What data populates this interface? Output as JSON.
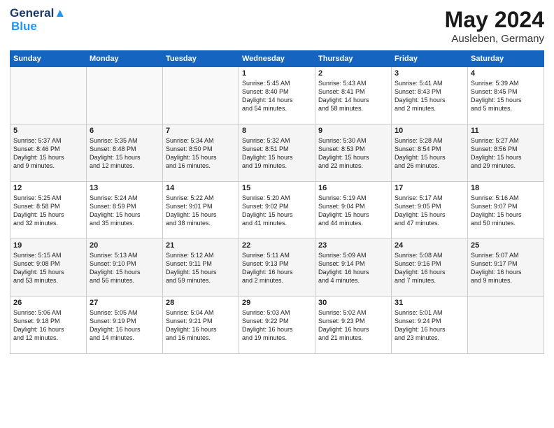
{
  "header": {
    "logo_line1": "General",
    "logo_line2": "Blue",
    "month": "May 2024",
    "location": "Ausleben, Germany"
  },
  "weekdays": [
    "Sunday",
    "Monday",
    "Tuesday",
    "Wednesday",
    "Thursday",
    "Friday",
    "Saturday"
  ],
  "weeks": [
    [
      {
        "day": "",
        "info": ""
      },
      {
        "day": "",
        "info": ""
      },
      {
        "day": "",
        "info": ""
      },
      {
        "day": "1",
        "info": "Sunrise: 5:45 AM\nSunset: 8:40 PM\nDaylight: 14 hours\nand 54 minutes."
      },
      {
        "day": "2",
        "info": "Sunrise: 5:43 AM\nSunset: 8:41 PM\nDaylight: 14 hours\nand 58 minutes."
      },
      {
        "day": "3",
        "info": "Sunrise: 5:41 AM\nSunset: 8:43 PM\nDaylight: 15 hours\nand 2 minutes."
      },
      {
        "day": "4",
        "info": "Sunrise: 5:39 AM\nSunset: 8:45 PM\nDaylight: 15 hours\nand 5 minutes."
      }
    ],
    [
      {
        "day": "5",
        "info": "Sunrise: 5:37 AM\nSunset: 8:46 PM\nDaylight: 15 hours\nand 9 minutes."
      },
      {
        "day": "6",
        "info": "Sunrise: 5:35 AM\nSunset: 8:48 PM\nDaylight: 15 hours\nand 12 minutes."
      },
      {
        "day": "7",
        "info": "Sunrise: 5:34 AM\nSunset: 8:50 PM\nDaylight: 15 hours\nand 16 minutes."
      },
      {
        "day": "8",
        "info": "Sunrise: 5:32 AM\nSunset: 8:51 PM\nDaylight: 15 hours\nand 19 minutes."
      },
      {
        "day": "9",
        "info": "Sunrise: 5:30 AM\nSunset: 8:53 PM\nDaylight: 15 hours\nand 22 minutes."
      },
      {
        "day": "10",
        "info": "Sunrise: 5:28 AM\nSunset: 8:54 PM\nDaylight: 15 hours\nand 26 minutes."
      },
      {
        "day": "11",
        "info": "Sunrise: 5:27 AM\nSunset: 8:56 PM\nDaylight: 15 hours\nand 29 minutes."
      }
    ],
    [
      {
        "day": "12",
        "info": "Sunrise: 5:25 AM\nSunset: 8:58 PM\nDaylight: 15 hours\nand 32 minutes."
      },
      {
        "day": "13",
        "info": "Sunrise: 5:24 AM\nSunset: 8:59 PM\nDaylight: 15 hours\nand 35 minutes."
      },
      {
        "day": "14",
        "info": "Sunrise: 5:22 AM\nSunset: 9:01 PM\nDaylight: 15 hours\nand 38 minutes."
      },
      {
        "day": "15",
        "info": "Sunrise: 5:20 AM\nSunset: 9:02 PM\nDaylight: 15 hours\nand 41 minutes."
      },
      {
        "day": "16",
        "info": "Sunrise: 5:19 AM\nSunset: 9:04 PM\nDaylight: 15 hours\nand 44 minutes."
      },
      {
        "day": "17",
        "info": "Sunrise: 5:17 AM\nSunset: 9:05 PM\nDaylight: 15 hours\nand 47 minutes."
      },
      {
        "day": "18",
        "info": "Sunrise: 5:16 AM\nSunset: 9:07 PM\nDaylight: 15 hours\nand 50 minutes."
      }
    ],
    [
      {
        "day": "19",
        "info": "Sunrise: 5:15 AM\nSunset: 9:08 PM\nDaylight: 15 hours\nand 53 minutes."
      },
      {
        "day": "20",
        "info": "Sunrise: 5:13 AM\nSunset: 9:10 PM\nDaylight: 15 hours\nand 56 minutes."
      },
      {
        "day": "21",
        "info": "Sunrise: 5:12 AM\nSunset: 9:11 PM\nDaylight: 15 hours\nand 59 minutes."
      },
      {
        "day": "22",
        "info": "Sunrise: 5:11 AM\nSunset: 9:13 PM\nDaylight: 16 hours\nand 2 minutes."
      },
      {
        "day": "23",
        "info": "Sunrise: 5:09 AM\nSunset: 9:14 PM\nDaylight: 16 hours\nand 4 minutes."
      },
      {
        "day": "24",
        "info": "Sunrise: 5:08 AM\nSunset: 9:16 PM\nDaylight: 16 hours\nand 7 minutes."
      },
      {
        "day": "25",
        "info": "Sunrise: 5:07 AM\nSunset: 9:17 PM\nDaylight: 16 hours\nand 9 minutes."
      }
    ],
    [
      {
        "day": "26",
        "info": "Sunrise: 5:06 AM\nSunset: 9:18 PM\nDaylight: 16 hours\nand 12 minutes."
      },
      {
        "day": "27",
        "info": "Sunrise: 5:05 AM\nSunset: 9:19 PM\nDaylight: 16 hours\nand 14 minutes."
      },
      {
        "day": "28",
        "info": "Sunrise: 5:04 AM\nSunset: 9:21 PM\nDaylight: 16 hours\nand 16 minutes."
      },
      {
        "day": "29",
        "info": "Sunrise: 5:03 AM\nSunset: 9:22 PM\nDaylight: 16 hours\nand 19 minutes."
      },
      {
        "day": "30",
        "info": "Sunrise: 5:02 AM\nSunset: 9:23 PM\nDaylight: 16 hours\nand 21 minutes."
      },
      {
        "day": "31",
        "info": "Sunrise: 5:01 AM\nSunset: 9:24 PM\nDaylight: 16 hours\nand 23 minutes."
      },
      {
        "day": "",
        "info": ""
      }
    ]
  ]
}
